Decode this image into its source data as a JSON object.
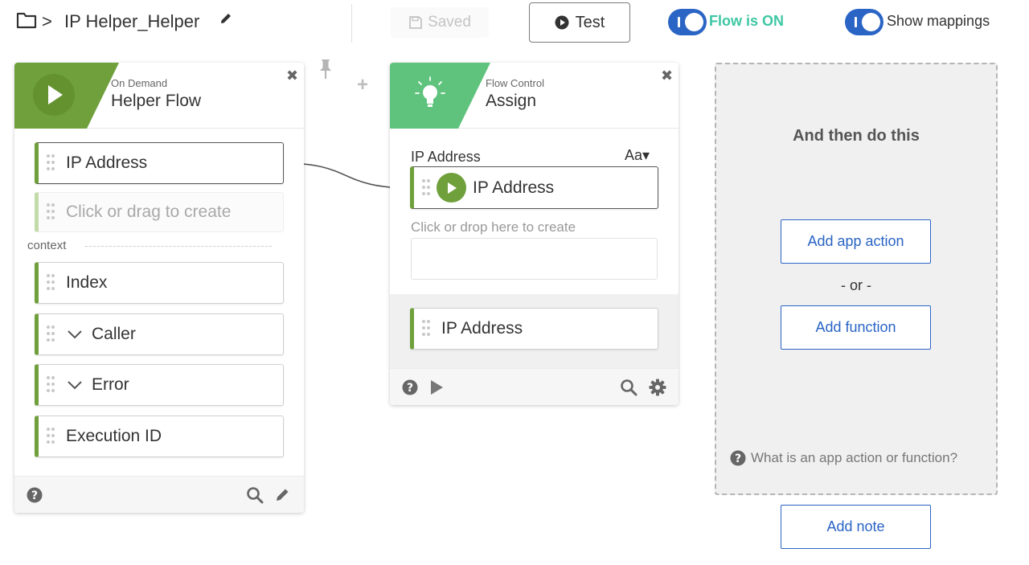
{
  "header": {
    "breadcrumb_sep": ">",
    "flow_title": "IP Helper_Helper",
    "saved_label": "Saved",
    "test_label": "Test",
    "flow_toggle_label": "Flow is ON",
    "mappings_toggle_label": "Show mappings"
  },
  "trigger_card": {
    "subtitle": "On Demand",
    "title": "Helper Flow",
    "close": "✖",
    "fields": [
      "IP Address"
    ],
    "create_placeholder": "Click or drag to create",
    "context_label": "context",
    "context_fields": [
      {
        "label": "Index",
        "expandable": false
      },
      {
        "label": "Caller",
        "expandable": true
      },
      {
        "label": "Error",
        "expandable": true
      },
      {
        "label": "Execution ID",
        "expandable": false
      }
    ]
  },
  "assign_card": {
    "subtitle": "Flow Control",
    "title": "Assign",
    "close": "✖",
    "var_label": "IP Address",
    "type_label": "Aa▾",
    "mapped_value": "IP Address",
    "drop_hint": "Click or drop here to create",
    "output_field": "IP Address"
  },
  "then_panel": {
    "title": "And then do this",
    "add_app_action": "Add app action",
    "or_text": "- or -",
    "add_function": "Add function",
    "help_text": "What is an app action or function?"
  },
  "add_note": "Add note",
  "colors": {
    "trigger_green": "#6fa03c",
    "assign_green": "#5fc37d",
    "toggle_blue": "#2a64c5",
    "flow_on_teal": "#3ec7a4"
  }
}
